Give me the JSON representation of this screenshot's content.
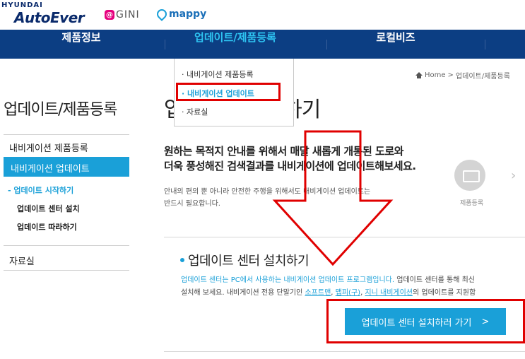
{
  "header": {
    "brand_top": "HYUNDAI",
    "brand_main": "AutoEver",
    "gini_icon_glyph": "@",
    "gini_label": "GINI",
    "mappy_label": "mappy"
  },
  "nav": {
    "items": [
      {
        "label": "제품정보"
      },
      {
        "label": "업데이트/제품등록"
      },
      {
        "label": "로컬비즈"
      }
    ]
  },
  "dropdown": {
    "items": [
      {
        "label": "· 내비게이션 제품등록"
      },
      {
        "label": "· 내비게이션 업데이트"
      },
      {
        "label": "· 자료실"
      }
    ]
  },
  "breadcrumb": {
    "home": "Home",
    "separator": ">",
    "current": "업데이트/제품등록"
  },
  "sidebar": {
    "title": "업데이트/제품등록",
    "items": [
      {
        "label": "내비게이션 제품등록"
      },
      {
        "label": "내비게이션 업데이트"
      },
      {
        "label": "자료실"
      }
    ],
    "sub_items": [
      {
        "label": "- 업데이트 시작하기"
      },
      {
        "label": "업데이트 센터 설치"
      },
      {
        "label": "업데이트 따라하기"
      }
    ]
  },
  "main": {
    "title_start": "업",
    "title_end": "하기",
    "headline_1": "원하는 목적지 안내를 위해서 매달 새롭게 개통된 도로와",
    "headline_2": "더욱 풍성해진 검색결과를 내비게이션에 업데이트해보세요.",
    "desc_1": "안내의 편의 뿐 아니라 안전한 주행을 위해서도 내비게이션 업데이트는",
    "desc_2": "반드시 필요합니다.",
    "product_label": "제품등록",
    "next_chevron": "›",
    "section_title": "업데이트 센터 설치하기",
    "section_desc_1a": "업데이트 센터는 PC에서 사용하는 내비게이션 업데이트 프로그램입니다.",
    "section_desc_1b": " 업데이트 센터를 통해 최신",
    "section_desc_2a": "설치해 보세요. 내비게이션 전용 단말기인 ",
    "section_desc_2b": "소프트맨",
    "section_desc_2c": ", ",
    "section_desc_2d": "맵피(구)",
    "section_desc_2e": ", ",
    "section_desc_2f": "지니 내비게이션",
    "section_desc_2g": "의 업데이트를 지원합",
    "install_button": "업데이트 센터 설치하러 가기",
    "install_button_chevron": ">"
  },
  "colors": {
    "nav_bg": "#0c3e83",
    "accent": "#1aa0d8",
    "highlight": "#e00000"
  }
}
